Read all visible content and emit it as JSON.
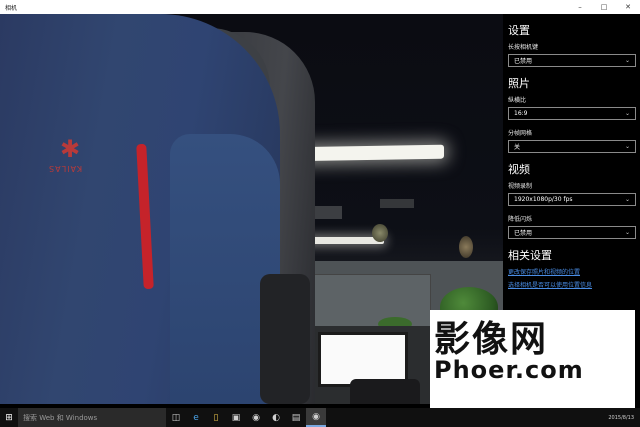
{
  "window": {
    "title": "相机",
    "minimize_icon": "minimize-icon",
    "maximize_icon": "maximize-icon",
    "close_icon": "close-icon"
  },
  "settings": {
    "heading": "设置",
    "hold_camera_label": "长按相机键",
    "hold_camera_value": "已禁用",
    "photos": {
      "heading": "照片",
      "aspect_label": "纵横比",
      "aspect_value": "16:9",
      "grid_label": "分帧网格",
      "grid_value": "关"
    },
    "video": {
      "heading": "视频",
      "record_label": "视频录制",
      "record_value": "1920x1080p/30 fps",
      "flicker_label": "降低闪烁",
      "flicker_value": "已禁用"
    },
    "related": {
      "heading": "相关设置",
      "link1": "更改保存照片和视频的位置",
      "link2": "选择相机是否可以使用位置信息"
    }
  },
  "preview": {
    "jacket_logo_text": "KAILAS"
  },
  "watermark": {
    "main": "影像网",
    "sub": "Phoer.com"
  },
  "taskbar": {
    "search_placeholder": "搜索 Web 和 Windows",
    "start_icon": "windows-start-icon",
    "icons": [
      "task-view-icon",
      "edge-icon",
      "file-explorer-icon",
      "store-icon",
      "app-icon",
      "app-icon-2",
      "app-icon-3",
      "camera-icon"
    ],
    "clock": "2015/8/13"
  },
  "colors": {
    "link": "#4a8ee6",
    "panel_bg": "#000000",
    "stripe_red": "#c5232a"
  }
}
